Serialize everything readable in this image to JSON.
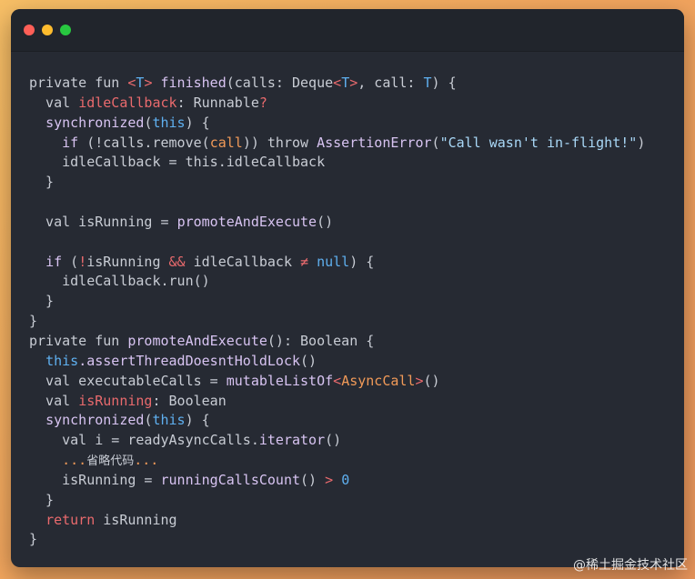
{
  "window_controls": [
    "close",
    "minimize",
    "maximize"
  ],
  "code_lines": [
    [
      [
        "plain",
        "private fun "
      ],
      [
        "kw-red",
        "<"
      ],
      [
        "param",
        "T"
      ],
      [
        "kw-red",
        "> "
      ],
      [
        "fn",
        "finished"
      ],
      [
        "plain",
        "(calls: Deque"
      ],
      [
        "kw-red",
        "<"
      ],
      [
        "param",
        "T"
      ],
      [
        "kw-red",
        ">"
      ],
      [
        "plain",
        ", call: "
      ],
      [
        "param",
        "T"
      ],
      [
        "plain",
        ") {"
      ]
    ],
    [
      [
        "plain",
        "  val "
      ],
      [
        "prop",
        "idleCallback"
      ],
      [
        "plain",
        ": Runnable"
      ],
      [
        "kw-red",
        "?"
      ]
    ],
    [
      [
        "plain",
        "  "
      ],
      [
        "fn",
        "synchronized"
      ],
      [
        "plain",
        "("
      ],
      [
        "kw-blue",
        "this"
      ],
      [
        "plain",
        ") {"
      ]
    ],
    [
      [
        "plain",
        "    "
      ],
      [
        "fn",
        "if"
      ],
      [
        "plain",
        " (!calls.remove("
      ],
      [
        "type",
        "call"
      ],
      [
        "plain",
        ")) throw "
      ],
      [
        "fn",
        "AssertionError"
      ],
      [
        "plain",
        "("
      ],
      [
        "string",
        "\"Call wasn't in-flight!\""
      ],
      [
        "plain",
        ")"
      ]
    ],
    [
      [
        "plain",
        "    idleCallback = this.idleCallback"
      ]
    ],
    [
      [
        "plain",
        "  }"
      ]
    ],
    [],
    [
      [
        "plain",
        "  val isRunning = "
      ],
      [
        "fn",
        "promoteAndExecute"
      ],
      [
        "plain",
        "()"
      ]
    ],
    [],
    [
      [
        "plain",
        "  "
      ],
      [
        "fn",
        "if"
      ],
      [
        "plain",
        " ("
      ],
      [
        "op",
        "!"
      ],
      [
        "plain",
        "isRunning "
      ],
      [
        "op",
        "&&"
      ],
      [
        "plain",
        " idleCallback "
      ],
      [
        "op",
        "≠"
      ],
      [
        "plain",
        " "
      ],
      [
        "kw-blue",
        "null"
      ],
      [
        "plain",
        ") {"
      ]
    ],
    [
      [
        "plain",
        "    idleCallback.run()"
      ]
    ],
    [
      [
        "plain",
        "  }"
      ]
    ],
    [
      [
        "plain",
        "}"
      ]
    ],
    [
      [
        "plain",
        "private fun "
      ],
      [
        "fn",
        "promoteAndExecute"
      ],
      [
        "plain",
        "(): Boolean {"
      ]
    ],
    [
      [
        "plain",
        "  "
      ],
      [
        "kw-blue",
        "this"
      ],
      [
        "fn",
        ".assertThreadDoesntHoldLock"
      ],
      [
        "plain",
        "()"
      ]
    ],
    [
      [
        "plain",
        "  val executableCalls = "
      ],
      [
        "fn",
        "mutableListOf"
      ],
      [
        "kw-red",
        "<"
      ],
      [
        "type",
        "AsyncCall"
      ],
      [
        "kw-red",
        ">"
      ],
      [
        "plain",
        "()"
      ]
    ],
    [
      [
        "plain",
        "  val "
      ],
      [
        "prop",
        "isRunning"
      ],
      [
        "plain",
        ": Boolean"
      ]
    ],
    [
      [
        "plain",
        "  "
      ],
      [
        "fn",
        "synchronized"
      ],
      [
        "plain",
        "("
      ],
      [
        "kw-blue",
        "this"
      ],
      [
        "plain",
        ") {"
      ]
    ],
    [
      [
        "plain",
        "    val i = readyAsyncCalls."
      ],
      [
        "fn",
        "iterator"
      ],
      [
        "plain",
        "()"
      ]
    ],
    [
      [
        "type",
        "    ..."
      ],
      [
        "comment",
        "省略代码"
      ],
      [
        "type",
        "..."
      ]
    ],
    [
      [
        "plain",
        "    isRunning = "
      ],
      [
        "fn",
        "runningCallsCount"
      ],
      [
        "plain",
        "() "
      ],
      [
        "op",
        ">"
      ],
      [
        "plain",
        " "
      ],
      [
        "number",
        "0"
      ]
    ],
    [
      [
        "plain",
        "  }"
      ]
    ],
    [
      [
        "plain",
        "  "
      ],
      [
        "kw-red",
        "return"
      ],
      [
        "plain",
        " isRunning"
      ]
    ],
    [
      [
        "plain",
        "}"
      ]
    ]
  ],
  "watermark": "@稀土掘金技术社区"
}
